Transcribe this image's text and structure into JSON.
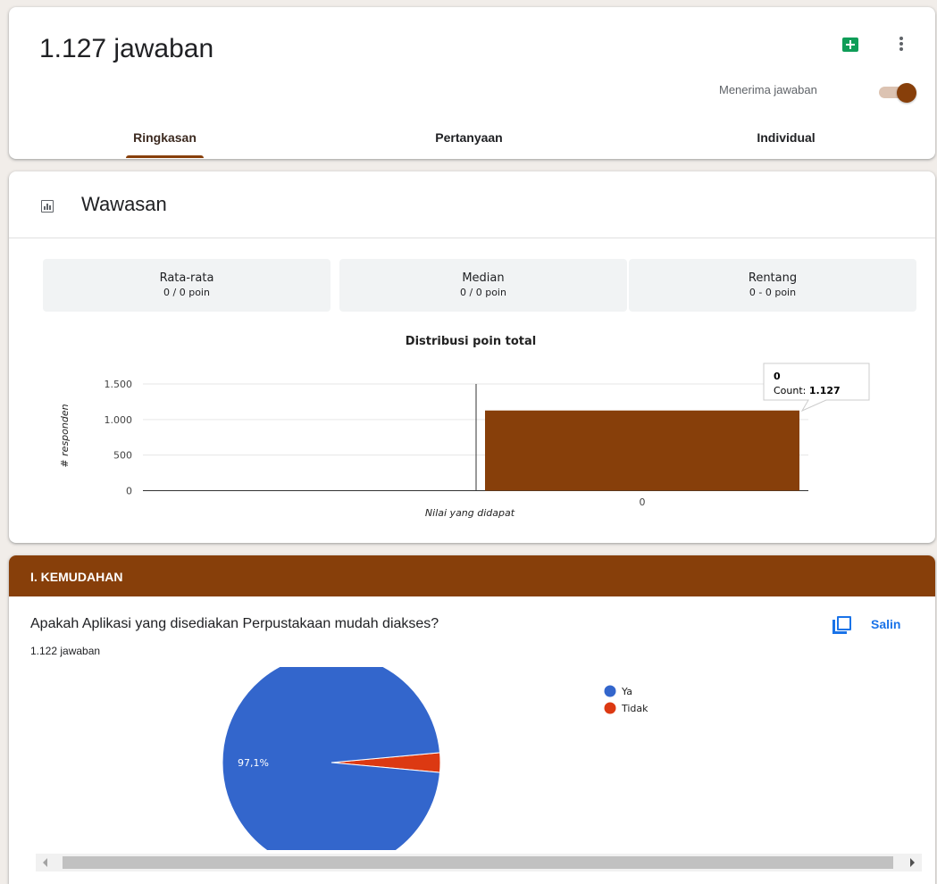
{
  "header": {
    "title": "1.127 jawaban",
    "sheets_icon": "google-sheets-icon",
    "more_icon": "more-vert-icon",
    "accepting_label": "Menerima jawaban",
    "accepting_on": true,
    "tabs": [
      {
        "label": "Ringkasan",
        "active": true
      },
      {
        "label": "Pertanyaan",
        "active": false
      },
      {
        "label": "Individual",
        "active": false
      }
    ]
  },
  "insights": {
    "title": "Wawasan",
    "icon": "insights-chart-icon",
    "stats": [
      {
        "label": "Rata-rata",
        "value": "0 / 0 poin"
      },
      {
        "label": "Median",
        "value": "0 / 0 poin"
      },
      {
        "label": "Rentang",
        "value": "0 - 0 poin"
      }
    ]
  },
  "section": {
    "title": "I. KEMUDAHAN",
    "question": "Apakah Aplikasi yang disediakan Perpustakaan mudah diakses?",
    "answer_count": "1.122 jawaban",
    "copy_label": "Salin",
    "copy_icon": "copy-icon"
  },
  "scrollbar": {
    "arrows": [
      "left-arrow-icon",
      "right-arrow-icon"
    ]
  },
  "colors": {
    "accent": "#873f0a",
    "blue": "#3366cc",
    "red": "#dc3912",
    "link": "#1a73e8"
  },
  "chart_data": [
    {
      "type": "bar",
      "title": "Distribusi poin total",
      "xlabel": "Nilai yang didapat",
      "ylabel": "# responden",
      "categories": [
        "0"
      ],
      "values": [
        1127
      ],
      "ylim": [
        0,
        1500
      ],
      "yticks": [
        "0",
        "500",
        "1.000",
        "1.500"
      ],
      "tooltip": {
        "category": "0",
        "label": "Count:",
        "value": "1.127"
      },
      "color": "#873f0a"
    },
    {
      "type": "pie",
      "labels": [
        "Ya",
        "Tidak"
      ],
      "values": [
        97.1,
        2.9
      ],
      "slice_label": "97,1%",
      "colors": [
        "#3366cc",
        "#dc3912"
      ],
      "legend": "right"
    }
  ]
}
